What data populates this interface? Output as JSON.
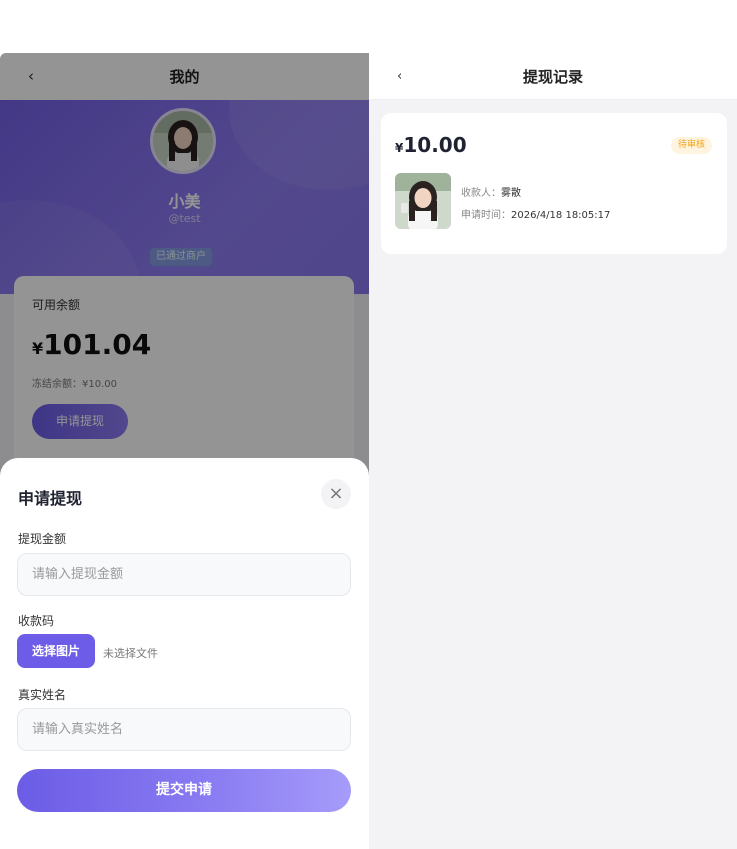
{
  "left": {
    "nav": {
      "back": "‹",
      "title": "我的"
    },
    "profile": {
      "name": "小美",
      "handle": "@test",
      "badge": "已通过商户"
    },
    "balance": {
      "label": "可用余额",
      "currency": "¥",
      "amount": "101.04",
      "frozen": "冻结余额：¥10.00",
      "apply_button": "申请提现"
    }
  },
  "sheet": {
    "title": "申请提现",
    "close": "×",
    "amount_label": "提现金额",
    "amount_placeholder": "请输入提现金额",
    "qr_label": "收款码",
    "pick_button": "选择图片",
    "no_file": "未选择文件",
    "name_label": "真实姓名",
    "name_placeholder": "请输入真实姓名",
    "submit": "提交申请"
  },
  "right": {
    "nav": {
      "back": "‹",
      "title": "提现记录"
    },
    "records": [
      {
        "currency": "¥",
        "amount": "10.00",
        "status": "待审核",
        "payee_label": "收款人：",
        "payee": "雾散",
        "time_label": "申请时间：",
        "time": "2026/4/18 18:05:17"
      }
    ]
  },
  "colors": {
    "accent": "#6c5ce7",
    "pending": "#f0a41d",
    "overlay": "rgba(0,0,0,0.42)"
  }
}
